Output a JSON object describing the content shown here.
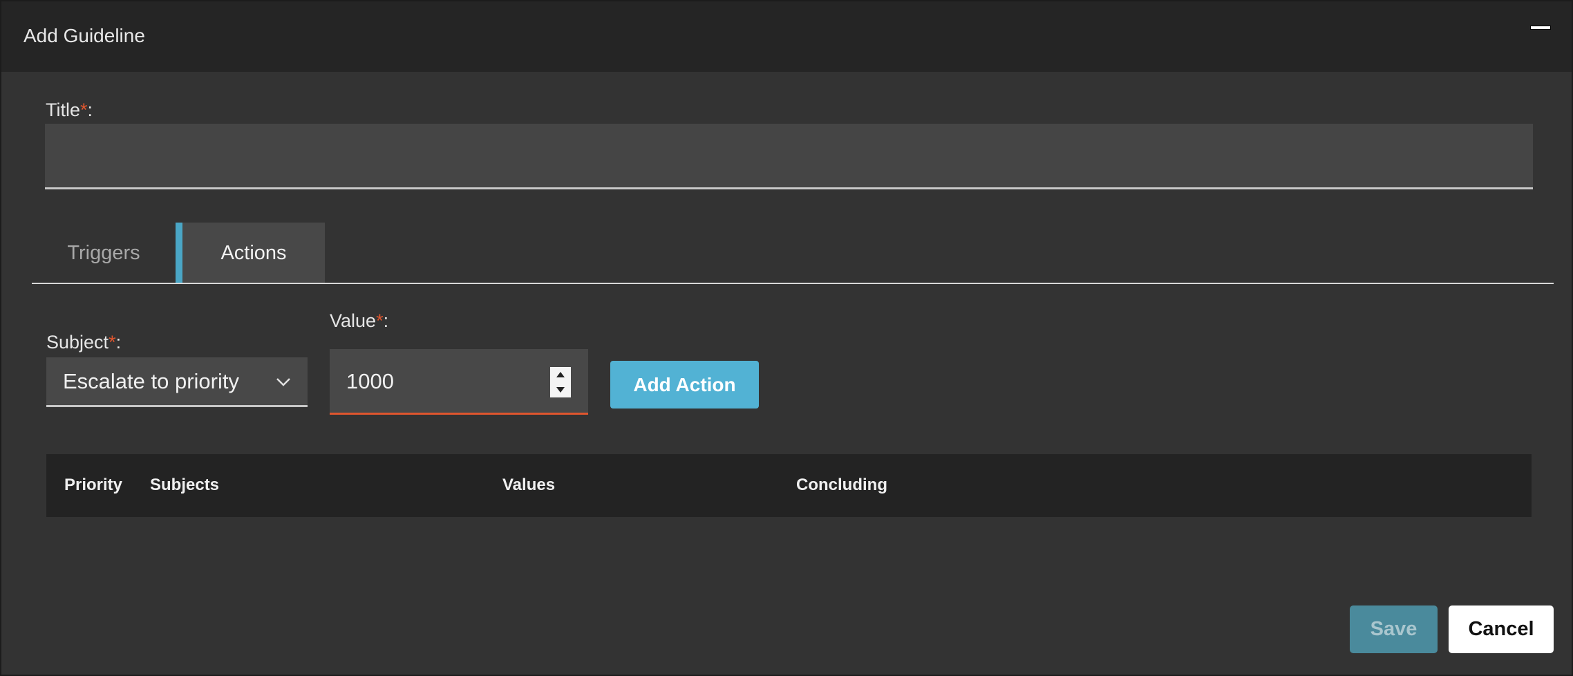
{
  "dialog": {
    "title": "Add Guideline"
  },
  "form": {
    "title_label": "Title",
    "title_value": "",
    "required_mark": "*",
    "colon": ":"
  },
  "tabs": [
    {
      "label": "Triggers",
      "active": false
    },
    {
      "label": "Actions",
      "active": true
    }
  ],
  "actions": {
    "subject_label": "Subject",
    "subject_value": "Escalate to priority",
    "value_label": "Value",
    "value_value": "1000",
    "add_action_label": "Add Action"
  },
  "table": {
    "columns": [
      "Priority",
      "Subjects",
      "Values",
      "Concluding"
    ]
  },
  "footer": {
    "save_label": "Save",
    "cancel_label": "Cancel"
  },
  "colors": {
    "accent": "#52b2d4",
    "required": "#e0562e",
    "background": "#333333",
    "header": "#252525"
  },
  "icons": [
    "minimize-icon",
    "chevron-down-icon",
    "spinner-up-icon",
    "spinner-down-icon"
  ]
}
